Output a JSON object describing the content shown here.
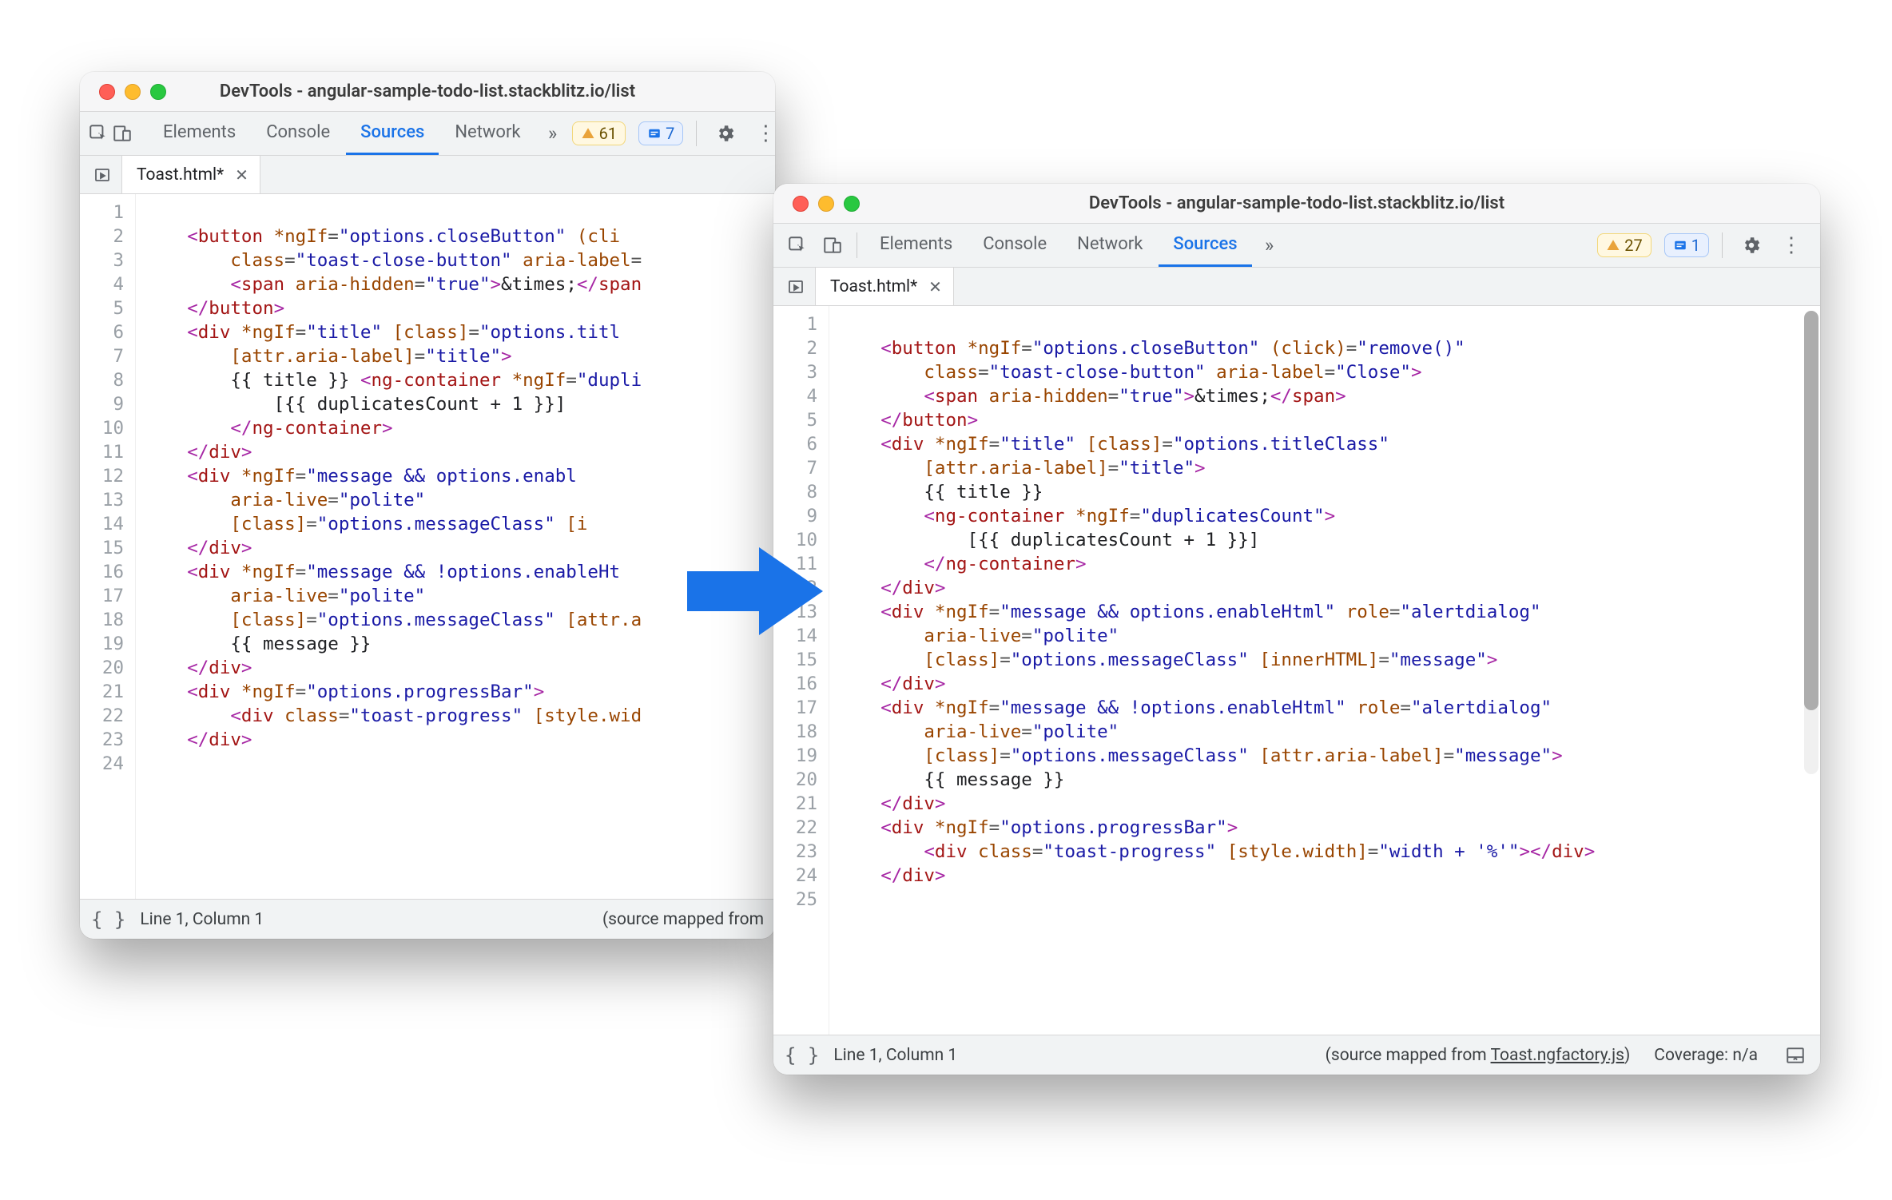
{
  "windowA": {
    "title": "DevTools - angular-sample-todo-list.stackblitz.io/list",
    "tabs": [
      "Elements",
      "Console",
      "Sources",
      "Network"
    ],
    "activeTab": "Sources",
    "warnings": "61",
    "issues": "7",
    "fileTab": "Toast.html*",
    "status": {
      "cursor": "Line 1, Column 1",
      "mapped": "(source mapped from "
    },
    "code": [
      "",
      {
        "indent": 2,
        "tokens": [
          [
            "p",
            "<"
          ],
          [
            "tn",
            "button"
          ],
          [
            "tx",
            " "
          ],
          [
            "an",
            "*ngIf"
          ],
          [
            "eq",
            "="
          ],
          [
            "q",
            "\"options.closeButton\""
          ],
          [
            "tx",
            " "
          ],
          [
            "an",
            "(cli"
          ]
        ]
      },
      {
        "indent": 4,
        "tokens": [
          [
            "an",
            "class"
          ],
          [
            "eq",
            "="
          ],
          [
            "q",
            "\"toast-close-button\""
          ],
          [
            "tx",
            " "
          ],
          [
            "an",
            "aria-label"
          ],
          [
            "eq",
            "="
          ]
        ]
      },
      {
        "indent": 4,
        "tokens": [
          [
            "p",
            "<"
          ],
          [
            "tn",
            "span"
          ],
          [
            "tx",
            " "
          ],
          [
            "an",
            "aria-hidden"
          ],
          [
            "eq",
            "="
          ],
          [
            "q",
            "\"true\""
          ],
          [
            "p",
            ">"
          ],
          [
            "tx",
            "&times;"
          ],
          [
            "p",
            "</"
          ],
          [
            "tn",
            "span"
          ]
        ]
      },
      {
        "indent": 2,
        "tokens": [
          [
            "p",
            "</"
          ],
          [
            "tn",
            "button"
          ],
          [
            "p",
            ">"
          ]
        ]
      },
      {
        "indent": 2,
        "tokens": [
          [
            "p",
            "<"
          ],
          [
            "tn",
            "div"
          ],
          [
            "tx",
            " "
          ],
          [
            "an",
            "*ngIf"
          ],
          [
            "eq",
            "="
          ],
          [
            "q",
            "\"title\""
          ],
          [
            "tx",
            " "
          ],
          [
            "an",
            "[class]"
          ],
          [
            "eq",
            "="
          ],
          [
            "q",
            "\"options.titl"
          ]
        ]
      },
      {
        "indent": 4,
        "tokens": [
          [
            "an",
            "[attr.aria-label]"
          ],
          [
            "eq",
            "="
          ],
          [
            "q",
            "\"title\""
          ],
          [
            "p",
            ">"
          ]
        ]
      },
      {
        "indent": 4,
        "tokens": [
          [
            "brace",
            "{{ title }}"
          ],
          [
            "tx",
            " "
          ],
          [
            "p",
            "<"
          ],
          [
            "tn",
            "ng-container"
          ],
          [
            "tx",
            " "
          ],
          [
            "an",
            "*ngIf"
          ],
          [
            "eq",
            "="
          ],
          [
            "q",
            "\"dupli"
          ]
        ]
      },
      {
        "indent": 6,
        "tokens": [
          [
            "brace",
            "[{{ duplicatesCount + 1 }}]"
          ]
        ]
      },
      {
        "indent": 4,
        "tokens": [
          [
            "p",
            "</"
          ],
          [
            "tn",
            "ng-container"
          ],
          [
            "p",
            ">"
          ]
        ]
      },
      {
        "indent": 2,
        "tokens": [
          [
            "p",
            "</"
          ],
          [
            "tn",
            "div"
          ],
          [
            "p",
            ">"
          ]
        ]
      },
      {
        "indent": 2,
        "tokens": [
          [
            "p",
            "<"
          ],
          [
            "tn",
            "div"
          ],
          [
            "tx",
            " "
          ],
          [
            "an",
            "*ngIf"
          ],
          [
            "eq",
            "="
          ],
          [
            "q",
            "\"message && options.enabl"
          ]
        ]
      },
      {
        "indent": 4,
        "tokens": [
          [
            "an",
            "aria-live"
          ],
          [
            "eq",
            "="
          ],
          [
            "q",
            "\"polite\""
          ]
        ]
      },
      {
        "indent": 4,
        "tokens": [
          [
            "an",
            "[class]"
          ],
          [
            "eq",
            "="
          ],
          [
            "q",
            "\"options.messageClass\""
          ],
          [
            "tx",
            " "
          ],
          [
            "an",
            "[i"
          ]
        ]
      },
      {
        "indent": 2,
        "tokens": [
          [
            "p",
            "</"
          ],
          [
            "tn",
            "div"
          ],
          [
            "p",
            ">"
          ]
        ]
      },
      {
        "indent": 2,
        "tokens": [
          [
            "p",
            "<"
          ],
          [
            "tn",
            "div"
          ],
          [
            "tx",
            " "
          ],
          [
            "an",
            "*ngIf"
          ],
          [
            "eq",
            "="
          ],
          [
            "q",
            "\"message && !options.enableHt"
          ]
        ]
      },
      {
        "indent": 4,
        "tokens": [
          [
            "an",
            "aria-live"
          ],
          [
            "eq",
            "="
          ],
          [
            "q",
            "\"polite\""
          ]
        ]
      },
      {
        "indent": 4,
        "tokens": [
          [
            "an",
            "[class]"
          ],
          [
            "eq",
            "="
          ],
          [
            "q",
            "\"options.messageClass\""
          ],
          [
            "tx",
            " "
          ],
          [
            "an",
            "[attr.a"
          ]
        ]
      },
      {
        "indent": 4,
        "tokens": [
          [
            "brace",
            "{{ message }}"
          ]
        ]
      },
      {
        "indent": 2,
        "tokens": [
          [
            "p",
            "</"
          ],
          [
            "tn",
            "div"
          ],
          [
            "p",
            ">"
          ]
        ]
      },
      {
        "indent": 2,
        "tokens": [
          [
            "p",
            "<"
          ],
          [
            "tn",
            "div"
          ],
          [
            "tx",
            " "
          ],
          [
            "an",
            "*ngIf"
          ],
          [
            "eq",
            "="
          ],
          [
            "q",
            "\"options.progressBar\""
          ],
          [
            "p",
            ">"
          ]
        ]
      },
      {
        "indent": 4,
        "tokens": [
          [
            "p",
            "<"
          ],
          [
            "tn",
            "div"
          ],
          [
            "tx",
            " "
          ],
          [
            "an",
            "class"
          ],
          [
            "eq",
            "="
          ],
          [
            "q",
            "\"toast-progress\""
          ],
          [
            "tx",
            " "
          ],
          [
            "an",
            "[style.wid"
          ]
        ]
      },
      {
        "indent": 2,
        "tokens": [
          [
            "p",
            "</"
          ],
          [
            "tn",
            "div"
          ],
          [
            "p",
            ">"
          ]
        ]
      },
      ""
    ],
    "lineCount": 24
  },
  "windowB": {
    "title": "DevTools - angular-sample-todo-list.stackblitz.io/list",
    "tabs": [
      "Elements",
      "Console",
      "Network",
      "Sources"
    ],
    "activeTab": "Sources",
    "warnings": "27",
    "issues": "1",
    "fileTab": "Toast.html*",
    "status": {
      "cursor": "Line 1, Column 1",
      "mappedPrefix": "(source mapped from ",
      "mappedLink": "Toast.ngfactory.js",
      "mappedSuffix": ")",
      "coverage": "Coverage: n/a"
    },
    "code": [
      "",
      {
        "indent": 2,
        "tokens": [
          [
            "p",
            "<"
          ],
          [
            "tn",
            "button"
          ],
          [
            "tx",
            " "
          ],
          [
            "an",
            "*ngIf"
          ],
          [
            "eq",
            "="
          ],
          [
            "q",
            "\"options.closeButton\""
          ],
          [
            "tx",
            " "
          ],
          [
            "an",
            "(click)"
          ],
          [
            "eq",
            "="
          ],
          [
            "q",
            "\"remove()\""
          ]
        ]
      },
      {
        "indent": 4,
        "tokens": [
          [
            "an",
            "class"
          ],
          [
            "eq",
            "="
          ],
          [
            "q",
            "\"toast-close-button\""
          ],
          [
            "tx",
            " "
          ],
          [
            "an",
            "aria-label"
          ],
          [
            "eq",
            "="
          ],
          [
            "q",
            "\"Close\""
          ],
          [
            "p",
            ">"
          ]
        ]
      },
      {
        "indent": 4,
        "tokens": [
          [
            "p",
            "<"
          ],
          [
            "tn",
            "span"
          ],
          [
            "tx",
            " "
          ],
          [
            "an",
            "aria-hidden"
          ],
          [
            "eq",
            "="
          ],
          [
            "q",
            "\"true\""
          ],
          [
            "p",
            ">"
          ],
          [
            "tx",
            "&times;"
          ],
          [
            "p",
            "</"
          ],
          [
            "tn",
            "span"
          ],
          [
            "p",
            ">"
          ]
        ]
      },
      {
        "indent": 2,
        "tokens": [
          [
            "p",
            "</"
          ],
          [
            "tn",
            "button"
          ],
          [
            "p",
            ">"
          ]
        ]
      },
      {
        "indent": 2,
        "tokens": [
          [
            "p",
            "<"
          ],
          [
            "tn",
            "div"
          ],
          [
            "tx",
            " "
          ],
          [
            "an",
            "*ngIf"
          ],
          [
            "eq",
            "="
          ],
          [
            "q",
            "\"title\""
          ],
          [
            "tx",
            " "
          ],
          [
            "an",
            "[class]"
          ],
          [
            "eq",
            "="
          ],
          [
            "q",
            "\"options.titleClass\""
          ]
        ]
      },
      {
        "indent": 4,
        "tokens": [
          [
            "an",
            "[attr.aria-label]"
          ],
          [
            "eq",
            "="
          ],
          [
            "q",
            "\"title\""
          ],
          [
            "p",
            ">"
          ]
        ]
      },
      {
        "indent": 4,
        "tokens": [
          [
            "brace",
            "{{ title }}"
          ]
        ]
      },
      {
        "indent": 4,
        "tokens": [
          [
            "p",
            "<"
          ],
          [
            "tn",
            "ng-container"
          ],
          [
            "tx",
            " "
          ],
          [
            "an",
            "*ngIf"
          ],
          [
            "eq",
            "="
          ],
          [
            "q",
            "\"duplicatesCount\""
          ],
          [
            "p",
            ">"
          ]
        ]
      },
      {
        "indent": 6,
        "tokens": [
          [
            "brace",
            "[{{ duplicatesCount + 1 }}]"
          ]
        ]
      },
      {
        "indent": 4,
        "tokens": [
          [
            "p",
            "</"
          ],
          [
            "tn",
            "ng-container"
          ],
          [
            "p",
            ">"
          ]
        ]
      },
      {
        "indent": 2,
        "tokens": [
          [
            "p",
            "</"
          ],
          [
            "tn",
            "div"
          ],
          [
            "p",
            ">"
          ]
        ]
      },
      {
        "indent": 2,
        "tokens": [
          [
            "p",
            "<"
          ],
          [
            "tn",
            "div"
          ],
          [
            "tx",
            " "
          ],
          [
            "an",
            "*ngIf"
          ],
          [
            "eq",
            "="
          ],
          [
            "q",
            "\"message && options.enableHtml\""
          ],
          [
            "tx",
            " "
          ],
          [
            "an",
            "role"
          ],
          [
            "eq",
            "="
          ],
          [
            "q",
            "\"alertdialog\""
          ]
        ]
      },
      {
        "indent": 4,
        "tokens": [
          [
            "an",
            "aria-live"
          ],
          [
            "eq",
            "="
          ],
          [
            "q",
            "\"polite\""
          ]
        ]
      },
      {
        "indent": 4,
        "tokens": [
          [
            "an",
            "[class]"
          ],
          [
            "eq",
            "="
          ],
          [
            "q",
            "\"options.messageClass\""
          ],
          [
            "tx",
            " "
          ],
          [
            "an",
            "[innerHTML]"
          ],
          [
            "eq",
            "="
          ],
          [
            "q",
            "\"message\""
          ],
          [
            "p",
            ">"
          ]
        ]
      },
      {
        "indent": 2,
        "tokens": [
          [
            "p",
            "</"
          ],
          [
            "tn",
            "div"
          ],
          [
            "p",
            ">"
          ]
        ]
      },
      {
        "indent": 2,
        "tokens": [
          [
            "p",
            "<"
          ],
          [
            "tn",
            "div"
          ],
          [
            "tx",
            " "
          ],
          [
            "an",
            "*ngIf"
          ],
          [
            "eq",
            "="
          ],
          [
            "q",
            "\"message && !options.enableHtml\""
          ],
          [
            "tx",
            " "
          ],
          [
            "an",
            "role"
          ],
          [
            "eq",
            "="
          ],
          [
            "q",
            "\"alertdialog\""
          ]
        ]
      },
      {
        "indent": 4,
        "tokens": [
          [
            "an",
            "aria-live"
          ],
          [
            "eq",
            "="
          ],
          [
            "q",
            "\"polite\""
          ]
        ]
      },
      {
        "indent": 4,
        "tokens": [
          [
            "an",
            "[class]"
          ],
          [
            "eq",
            "="
          ],
          [
            "q",
            "\"options.messageClass\""
          ],
          [
            "tx",
            " "
          ],
          [
            "an",
            "[attr.aria-label]"
          ],
          [
            "eq",
            "="
          ],
          [
            "q",
            "\"message\""
          ],
          [
            "p",
            ">"
          ]
        ]
      },
      {
        "indent": 4,
        "tokens": [
          [
            "brace",
            "{{ message }}"
          ]
        ]
      },
      {
        "indent": 2,
        "tokens": [
          [
            "p",
            "</"
          ],
          [
            "tn",
            "div"
          ],
          [
            "p",
            ">"
          ]
        ]
      },
      {
        "indent": 2,
        "tokens": [
          [
            "p",
            "<"
          ],
          [
            "tn",
            "div"
          ],
          [
            "tx",
            " "
          ],
          [
            "an",
            "*ngIf"
          ],
          [
            "eq",
            "="
          ],
          [
            "q",
            "\"options.progressBar\""
          ],
          [
            "p",
            ">"
          ]
        ]
      },
      {
        "indent": 4,
        "tokens": [
          [
            "p",
            "<"
          ],
          [
            "tn",
            "div"
          ],
          [
            "tx",
            " "
          ],
          [
            "an",
            "class"
          ],
          [
            "eq",
            "="
          ],
          [
            "q",
            "\"toast-progress\""
          ],
          [
            "tx",
            " "
          ],
          [
            "an",
            "[style.width]"
          ],
          [
            "eq",
            "="
          ],
          [
            "q",
            "\"width + '%'\""
          ],
          [
            "p",
            "></"
          ],
          [
            "tn",
            "div"
          ],
          [
            "p",
            ">"
          ]
        ]
      },
      {
        "indent": 2,
        "tokens": [
          [
            "p",
            "</"
          ],
          [
            "tn",
            "div"
          ],
          [
            "p",
            ">"
          ]
        ]
      },
      ""
    ],
    "lineCount": 25
  }
}
